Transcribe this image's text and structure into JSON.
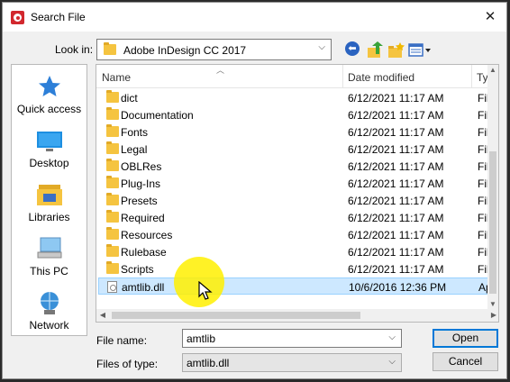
{
  "window": {
    "title": "Search File",
    "close_glyph": "✕"
  },
  "lookin": {
    "label": "Look in:",
    "value": "Adobe InDesign CC 2017"
  },
  "places": [
    {
      "label": "Quick access",
      "icon": "star-icon"
    },
    {
      "label": "Desktop",
      "icon": "desktop-icon"
    },
    {
      "label": "Libraries",
      "icon": "libraries-icon"
    },
    {
      "label": "This PC",
      "icon": "computer-icon"
    },
    {
      "label": "Network",
      "icon": "network-icon"
    }
  ],
  "columns": {
    "name": "Name",
    "date": "Date modified",
    "type": "Ty"
  },
  "rows": [
    {
      "name": "dict",
      "date": "6/12/2021 11:17 AM",
      "type": "Fil",
      "kind": "folder"
    },
    {
      "name": "Documentation",
      "date": "6/12/2021 11:17 AM",
      "type": "Fil",
      "kind": "folder"
    },
    {
      "name": "Fonts",
      "date": "6/12/2021 11:17 AM",
      "type": "Fil",
      "kind": "folder"
    },
    {
      "name": "Legal",
      "date": "6/12/2021 11:17 AM",
      "type": "Fil",
      "kind": "folder"
    },
    {
      "name": "OBLRes",
      "date": "6/12/2021 11:17 AM",
      "type": "Fil",
      "kind": "folder"
    },
    {
      "name": "Plug-Ins",
      "date": "6/12/2021 11:17 AM",
      "type": "Fil",
      "kind": "folder"
    },
    {
      "name": "Presets",
      "date": "6/12/2021 11:17 AM",
      "type": "Fil",
      "kind": "folder"
    },
    {
      "name": "Required",
      "date": "6/12/2021 11:17 AM",
      "type": "Fil",
      "kind": "folder"
    },
    {
      "name": "Resources",
      "date": "6/12/2021 11:17 AM",
      "type": "Fil",
      "kind": "folder"
    },
    {
      "name": "Rulebase",
      "date": "6/12/2021 11:17 AM",
      "type": "Fil",
      "kind": "folder"
    },
    {
      "name": "Scripts",
      "date": "6/12/2021 11:17 AM",
      "type": "Fil",
      "kind": "folder"
    },
    {
      "name": "amtlib.dll",
      "date": "10/6/2016 12:36 PM",
      "type": "Ap",
      "kind": "file",
      "selected": true
    }
  ],
  "filename": {
    "label": "File name:",
    "value": "amtlib"
  },
  "filetype": {
    "label": "Files of type:",
    "value": "amtlib.dll"
  },
  "buttons": {
    "open": "Open",
    "cancel": "Cancel"
  },
  "colors": {
    "selection": "#cde8ff",
    "accent": "#0078d7",
    "cursor_highlight": "#fff000"
  }
}
